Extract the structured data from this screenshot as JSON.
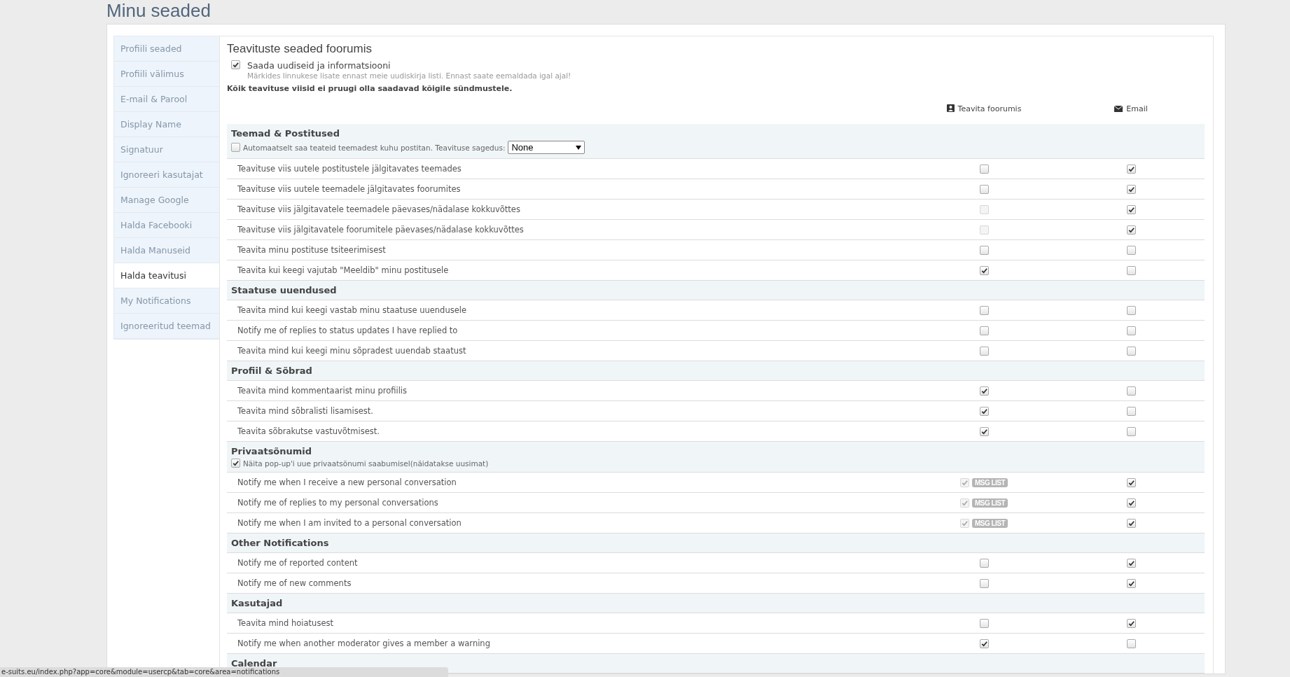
{
  "page_title": "Minu seaded",
  "sidebar": {
    "items": [
      {
        "label": "Profiili seaded",
        "selected": false
      },
      {
        "label": "Profiili välimus",
        "selected": false
      },
      {
        "label": "E-mail & Parool",
        "selected": false
      },
      {
        "label": "Display Name",
        "selected": false
      },
      {
        "label": "Signatuur",
        "selected": false
      },
      {
        "label": "Ignoreeri kasutajat",
        "selected": false
      },
      {
        "label": "Manage Google",
        "selected": false
      },
      {
        "label": "Halda Facebooki",
        "selected": false
      },
      {
        "label": "Halda Manuseid",
        "selected": false
      },
      {
        "label": "Halda teavitusi",
        "selected": true
      },
      {
        "label": "My Notifications",
        "selected": false
      },
      {
        "label": "Ignoreeritud teemad",
        "selected": false
      }
    ]
  },
  "panel": {
    "title": "Teavituste seaded foorumis",
    "newsletter": {
      "label": "Saada uudiseid ja informatsiooni",
      "checked": true,
      "hint": "Märkides linnukese lisate ennast meie uudiskirja listi. Ennast saate eemaldada igal ajal!"
    },
    "note": "Kõik teavituse viisid ei pruugi olla saadavad kõigile sündmustele.",
    "columns": [
      {
        "label": "Teavita foorumis",
        "kind": "person"
      },
      {
        "label": "Email",
        "kind": "mail"
      }
    ],
    "sections": [
      {
        "title": "Teemad & Postitused",
        "option": {
          "label": "Automaatselt saa teateid teemadest kuhu postitan. Teavituse sagedus:",
          "checked": false,
          "dropdown": "None"
        },
        "rows": [
          {
            "label": "Teavituse viis uutele postitustele jälgitavates teemades",
            "forum": {
              "checked": false,
              "disabled": false
            },
            "email": {
              "checked": true
            }
          },
          {
            "label": "Teavituse viis uutele teemadele jälgitavates foorumites",
            "forum": {
              "checked": false,
              "disabled": false
            },
            "email": {
              "checked": true
            }
          },
          {
            "label": "Teavituse viis jälgitavatele teemadele päevases/nädalase kokkuvõttes",
            "forum": {
              "checked": false,
              "disabled": true
            },
            "email": {
              "checked": true
            }
          },
          {
            "label": "Teavituse viis jälgitavatele foorumitele päevases/nädalase kokkuvõttes",
            "forum": {
              "checked": false,
              "disabled": true
            },
            "email": {
              "checked": true
            }
          },
          {
            "label": "Teavita minu postituse tsiteerimisest",
            "forum": {
              "checked": false,
              "disabled": false
            },
            "email": {
              "checked": false
            }
          },
          {
            "label": "Teavita kui keegi vajutab \"Meeldib\" minu postitusele",
            "forum": {
              "checked": true,
              "disabled": false
            },
            "email": {
              "checked": false
            }
          }
        ]
      },
      {
        "title": "Staatuse uuendused",
        "rows": [
          {
            "label": "Teavita mind kui keegi vastab minu staatuse uuendusele",
            "forum": {
              "checked": false,
              "disabled": false
            },
            "email": {
              "checked": false
            }
          },
          {
            "label": "Notify me of replies to status updates I have replied to",
            "forum": {
              "checked": false,
              "disabled": false
            },
            "email": {
              "checked": false
            }
          },
          {
            "label": "Teavita mind kui keegi minu sõpradest uuendab staatust",
            "forum": {
              "checked": false,
              "disabled": false
            },
            "email": {
              "checked": false
            }
          }
        ]
      },
      {
        "title": "Profiil & Sõbrad",
        "rows": [
          {
            "label": "Teavita mind kommentaarist minu profiilis",
            "forum": {
              "checked": true,
              "disabled": false
            },
            "email": {
              "checked": false
            }
          },
          {
            "label": "Teavita mind sõbralisti lisamisest.",
            "forum": {
              "checked": true,
              "disabled": false
            },
            "email": {
              "checked": false
            }
          },
          {
            "label": "Teavita sõbrakutse vastuvõtmisest.",
            "forum": {
              "checked": true,
              "disabled": false
            },
            "email": {
              "checked": false
            }
          }
        ]
      },
      {
        "title": "Privaatsõnumid",
        "option": {
          "label": "Näita pop-up'i uue privaatsõnumi saabumisel(näidatakse uusimat)",
          "checked": true
        },
        "rows": [
          {
            "label": "Notify me when I receive a new personal conversation",
            "forum": {
              "checked": true,
              "disabled": true,
              "badge": "MSG LIST"
            },
            "email": {
              "checked": true
            }
          },
          {
            "label": "Notify me of replies to my personal conversations",
            "forum": {
              "checked": true,
              "disabled": true,
              "badge": "MSG LIST"
            },
            "email": {
              "checked": true
            }
          },
          {
            "label": "Notify me when I am invited to a personal conversation",
            "forum": {
              "checked": true,
              "disabled": true,
              "badge": "MSG LIST"
            },
            "email": {
              "checked": true
            }
          }
        ]
      },
      {
        "title": "Other Notifications",
        "rows": [
          {
            "label": "Notify me of reported content",
            "forum": {
              "checked": false,
              "disabled": false
            },
            "email": {
              "checked": true
            }
          },
          {
            "label": "Notify me of new comments",
            "forum": {
              "checked": false,
              "disabled": false
            },
            "email": {
              "checked": true
            }
          }
        ]
      },
      {
        "title": "Kasutajad",
        "rows": [
          {
            "label": "Teavita mind hoiatusest",
            "forum": {
              "checked": false,
              "disabled": false
            },
            "email": {
              "checked": true
            }
          },
          {
            "label": "Notify me when another moderator gives a member a warning",
            "forum": {
              "checked": true,
              "disabled": false
            },
            "email": {
              "checked": false
            }
          }
        ]
      },
      {
        "title": "Calendar"
      }
    ]
  },
  "status_bar": {
    "url": "e-suits.eu/index.php?app=core&module=usercp&tab=core&area=notifications"
  }
}
